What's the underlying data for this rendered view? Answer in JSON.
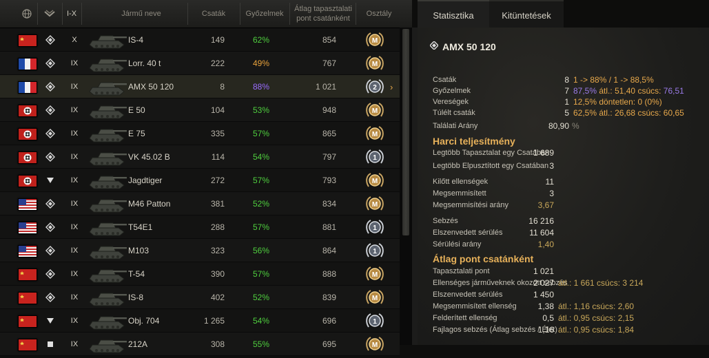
{
  "colors": {
    "win_green": "#4fcf3e",
    "win_orange": "#e8a23c",
    "win_purple": "#9a6cff",
    "accent": "#e7b15a"
  },
  "header": {
    "nation_icon": "globe-icon",
    "type_icon": "vehicle-type-icon",
    "tier": "I-X",
    "name": "Jármű neve",
    "battles": "Csaták",
    "wins": "Győzelmek",
    "avgxp": "Átlag tapasztalati pont csatánként",
    "class": "Osztály"
  },
  "rows": [
    {
      "nation": "ussr",
      "type": "heavy",
      "tier": "X",
      "name": "IS-4",
      "battles": "149",
      "wins": "62%",
      "win_color": "green",
      "avgxp": "854",
      "badge": "M"
    },
    {
      "nation": "france",
      "type": "heavy",
      "tier": "IX",
      "name": "Lorr. 40 t",
      "battles": "222",
      "wins": "49%",
      "win_color": "orange",
      "avgxp": "767",
      "badge": "M"
    },
    {
      "nation": "france",
      "type": "heavy",
      "tier": "IX",
      "name": "AMX 50 120",
      "battles": "8",
      "wins": "88%",
      "win_color": "purple",
      "avgxp": "1 021",
      "badge": "2",
      "selected": true
    },
    {
      "nation": "germany",
      "type": "heavy",
      "tier": "IX",
      "name": "E 50",
      "battles": "104",
      "wins": "53%",
      "win_color": "green",
      "avgxp": "948",
      "badge": "M"
    },
    {
      "nation": "germany",
      "type": "heavy",
      "tier": "IX",
      "name": "E 75",
      "battles": "335",
      "wins": "57%",
      "win_color": "green",
      "avgxp": "865",
      "badge": "M"
    },
    {
      "nation": "germany",
      "type": "heavy",
      "tier": "IX",
      "name": "VK 45.02 B",
      "battles": "114",
      "wins": "54%",
      "win_color": "green",
      "avgxp": "797",
      "badge": "1"
    },
    {
      "nation": "germany",
      "type": "td",
      "tier": "IX",
      "name": "Jagdtiger",
      "battles": "272",
      "wins": "57%",
      "win_color": "green",
      "avgxp": "793",
      "badge": "M"
    },
    {
      "nation": "usa",
      "type": "heavy",
      "tier": "IX",
      "name": "M46 Patton",
      "battles": "381",
      "wins": "52%",
      "win_color": "green",
      "avgxp": "834",
      "badge": "M"
    },
    {
      "nation": "usa",
      "type": "heavy",
      "tier": "IX",
      "name": "T54E1",
      "battles": "288",
      "wins": "57%",
      "win_color": "green",
      "avgxp": "881",
      "badge": "1"
    },
    {
      "nation": "usa",
      "type": "heavy",
      "tier": "IX",
      "name": "M103",
      "battles": "323",
      "wins": "56%",
      "win_color": "green",
      "avgxp": "864",
      "badge": "1"
    },
    {
      "nation": "ussr",
      "type": "heavy",
      "tier": "IX",
      "name": "T-54",
      "battles": "390",
      "wins": "57%",
      "win_color": "green",
      "avgxp": "888",
      "badge": "M"
    },
    {
      "nation": "ussr",
      "type": "heavy",
      "tier": "IX",
      "name": "IS-8",
      "battles": "402",
      "wins": "52%",
      "win_color": "green",
      "avgxp": "839",
      "badge": "M"
    },
    {
      "nation": "ussr",
      "type": "td",
      "tier": "IX",
      "name": "Obj. 704",
      "battles": "1 265",
      "wins": "54%",
      "win_color": "green",
      "avgxp": "696",
      "badge": "1"
    },
    {
      "nation": "ussr",
      "type": "light",
      "tier": "IX",
      "name": "212A",
      "battles": "308",
      "wins": "55%",
      "win_color": "green",
      "avgxp": "695",
      "badge": "M"
    }
  ],
  "tabs": {
    "stats": "Statisztika",
    "awards": "Kitüntetések"
  },
  "vehicle_title": "AMX 50 120",
  "stats": {
    "battles": {
      "label": "Csaták",
      "value": "8",
      "extra": "1 -> 88% / 1 -> 88,5%"
    },
    "wins": {
      "label": "Győzelmek",
      "value": "7",
      "pct": "87,5%",
      "extra1": "átl.:",
      "avg": "51,40",
      "extra2": "csúcs:",
      "best": "76,51"
    },
    "losses": {
      "label": "Vereségek",
      "value": "1",
      "pct": "12,5%",
      "extra1": "döntetlen:",
      "draws": "0 (0%)"
    },
    "survived": {
      "label": "Túlélt csaták",
      "value": "5",
      "pct": "62,5%",
      "extra1": "átl.:",
      "avg": "26,68",
      "extra2": "csúcs:",
      "best": "60,65"
    },
    "hitratio": {
      "label": "Találati Arány",
      "value": "80,90",
      "unit": "%"
    }
  },
  "combat": {
    "title": "Harci teljesítmény",
    "max_xp": {
      "label": "Legtöbb Tapasztalat egy Csatában",
      "value": "1 689"
    },
    "max_kills": {
      "label": "Legtöbb Elpusztított egy Csatában",
      "value": "3"
    },
    "spotted": {
      "label": "Kilőtt ellenségek",
      "value": "11"
    },
    "destroyed": {
      "label": "Megsemmisített",
      "value": "3"
    },
    "kd": {
      "label": "Megsemmisítési arány",
      "value": "3,67"
    },
    "dmg": {
      "label": "Sebzés",
      "value": "16 216"
    },
    "received": {
      "label": "Elszenvedett sérülés",
      "value": "11 604"
    },
    "dmg_ratio": {
      "label": "Sérülési arány",
      "value": "1,40"
    }
  },
  "average": {
    "title": "Átlag pont csatánként",
    "xp": {
      "label": "Tapasztalati pont",
      "value": "1 021"
    },
    "dmg": {
      "label": "Ellenséges járműveknek okozott sebzés",
      "value": "2 027",
      "extra": "átl.: 1 661 csúcs: 3 214"
    },
    "received": {
      "label": "Elszenvedett sérülés",
      "value": "1 450"
    },
    "frags": {
      "label": "Megsemmisített ellenség",
      "value": "1,38",
      "extra": "átl.: 1,16 csúcs: 2,60"
    },
    "spotted": {
      "label": "Felderített ellenség",
      "value": "0,5",
      "extra": "átl.: 0,95 csúcs: 2,15"
    },
    "eff": {
      "label": "Fajlagos sebzés (Átlag sebzés / Élet)",
      "value": "1,16",
      "extra": "átl.: 0,95 csúcs: 1,84"
    }
  }
}
